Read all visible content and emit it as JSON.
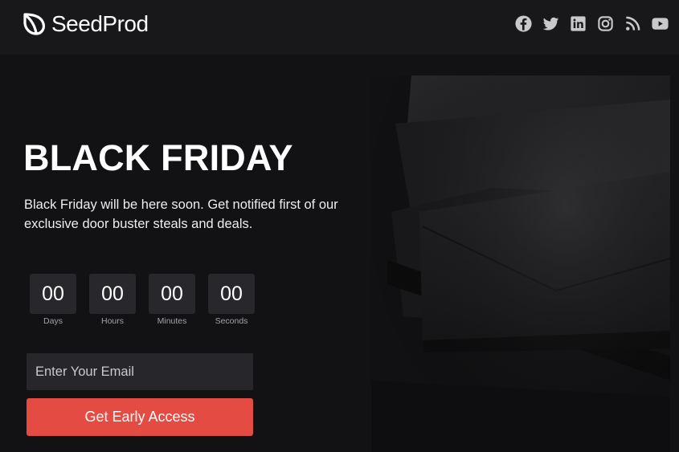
{
  "brand": {
    "name": "SeedProd",
    "logo_icon": "seedprod-leaf-icon"
  },
  "social_links": [
    {
      "name": "facebook-icon"
    },
    {
      "name": "twitter-icon"
    },
    {
      "name": "linkedin-icon"
    },
    {
      "name": "instagram-icon"
    },
    {
      "name": "rss-icon"
    },
    {
      "name": "youtube-icon"
    }
  ],
  "hero": {
    "title": "BLACK FRIDAY",
    "description": "Black Friday will be here soon. Get notified first of our exclusive door buster steals and deals.",
    "image": "black-envelopes-image"
  },
  "countdown": [
    {
      "value": "00",
      "label": "Days"
    },
    {
      "value": "00",
      "label": "Hours"
    },
    {
      "value": "00",
      "label": "Minutes"
    },
    {
      "value": "00",
      "label": "Seconds"
    }
  ],
  "form": {
    "email_placeholder": "Enter Your Email",
    "submit_label": "Get Early Access"
  },
  "colors": {
    "background": "#121214",
    "header": "#18181a",
    "accent": "#e44b43",
    "countdown_box": "#27272c",
    "input_bg": "#26262b"
  }
}
